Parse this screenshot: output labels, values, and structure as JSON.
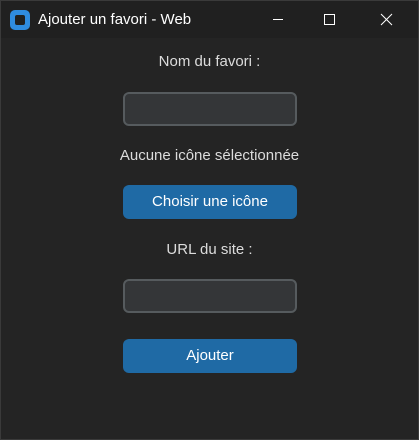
{
  "window": {
    "title": "Ajouter un favori - Web"
  },
  "titlebar": {
    "icon": "app-icon",
    "minimize_icon": "minimize-icon",
    "maximize_icon": "maximize-icon",
    "close_icon": "close-icon"
  },
  "form": {
    "name_label": "Nom du favori :",
    "name_value": "",
    "icon_status": "Aucune icône sélectionnée",
    "choose_icon_button": "Choisir une icône",
    "url_label": "URL du site :",
    "url_value": "",
    "submit_button": "Ajouter"
  },
  "colors": {
    "background": "#242424",
    "titlebar": "#202020",
    "field_bg": "#343638",
    "field_border": "#565b5e",
    "accent": "#1f6aa5"
  }
}
